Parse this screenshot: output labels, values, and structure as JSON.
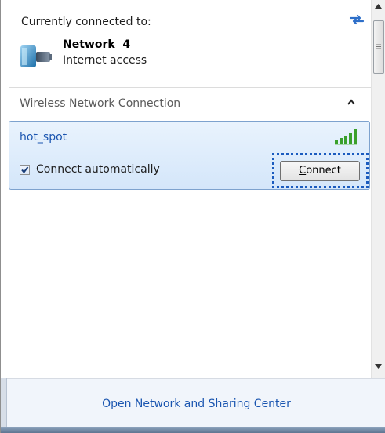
{
  "header": {
    "connected_label": "Currently connected to:",
    "refresh_icon": "refresh-arrows-icon"
  },
  "current_network": {
    "icon": "network-globe-icon",
    "name": "Network  4",
    "status": "Internet access"
  },
  "wireless_section": {
    "header": "Wireless Network Connection",
    "collapse_icon": "chevron-up-icon",
    "networks": [
      {
        "name": "hot_spot",
        "signal_icon": "signal-strength-icon",
        "connect_automatically_label": "Connect automatically",
        "connect_automatically_checked": true,
        "connect_button_label": "Connect"
      }
    ]
  },
  "footer": {
    "link_label": "Open Network and Sharing Center"
  },
  "colors": {
    "link": "#1a55b0",
    "selection_border": "#7da2ce",
    "focus_ring": "#1a5bbf",
    "signal_green": "#3aa02b"
  }
}
